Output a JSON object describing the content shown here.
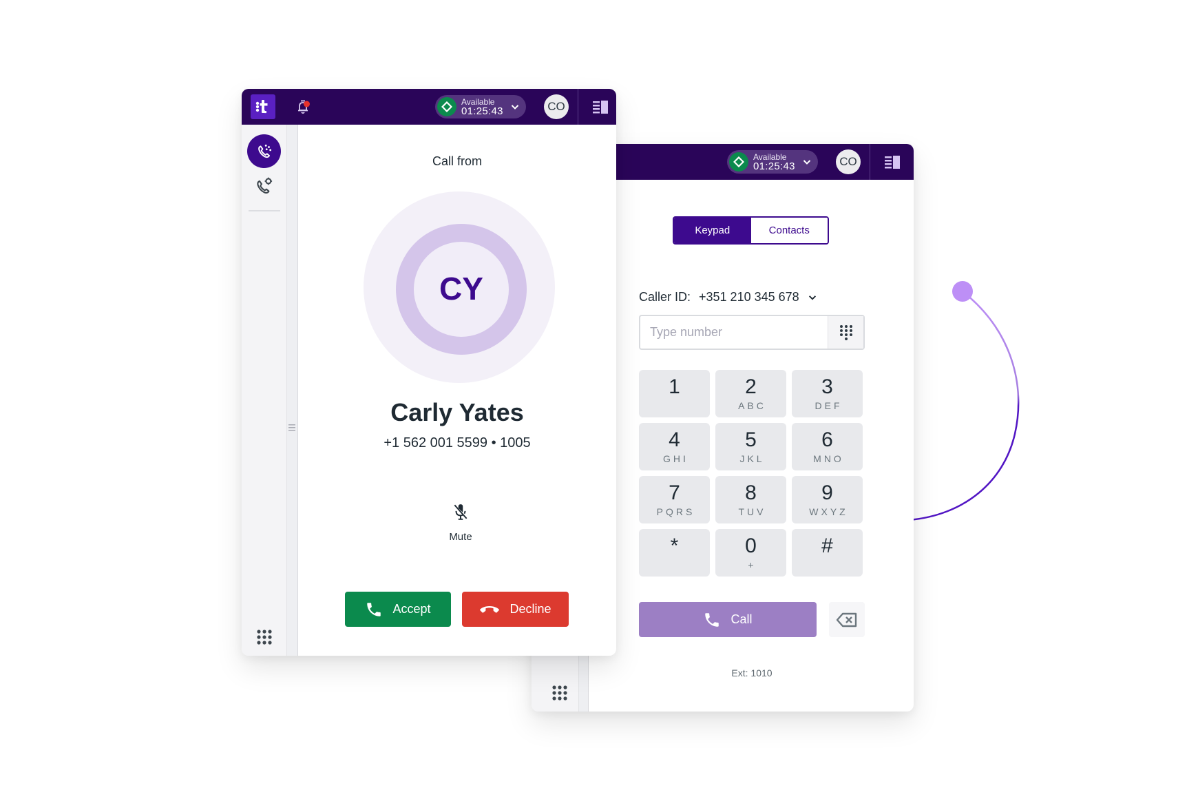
{
  "colors": {
    "header_bg": "#2a0559",
    "brand_purple": "#3d0a8e",
    "accept_green": "#0b8a4d",
    "decline_red": "#dc3a2f",
    "call_button_disabled": "#9c7fc4",
    "arc_light": "#bd8ff6",
    "arc_dark": "#5216c4"
  },
  "header": {
    "logo_icon": "talkdesk-logo-icon",
    "notification_icon": "bell-icon",
    "notification_badge": true,
    "status_label": "Available",
    "status_timer": "01:25:43",
    "status_icon": "diamond-icon",
    "user_initials": "CO",
    "panel_toggle_icon": "side-panel-icon"
  },
  "sidebar": {
    "items": [
      {
        "name": "incoming-call",
        "icon": "phone-ringing-icon",
        "active": true
      },
      {
        "name": "call-settings",
        "icon": "phone-settings-icon",
        "active": false
      }
    ],
    "apps_icon": "apps-grid-icon"
  },
  "incoming_call": {
    "heading": "Call from",
    "initials": "CY",
    "caller_name": "Carly Yates",
    "caller_number": "+1 562 001 5599 • 1005",
    "mute_label": "Mute",
    "accept_label": "Accept",
    "decline_label": "Decline"
  },
  "dialer": {
    "tabs": [
      {
        "label": "Keypad",
        "active": true
      },
      {
        "label": "Contacts",
        "active": false
      }
    ],
    "caller_id_label": "Caller ID:",
    "caller_id_value": "+351 210 345 678",
    "number_input_value": "",
    "number_input_placeholder": "Type number",
    "keys": [
      {
        "digit": "1",
        "letters": ""
      },
      {
        "digit": "2",
        "letters": "ABC"
      },
      {
        "digit": "3",
        "letters": "DEF"
      },
      {
        "digit": "4",
        "letters": "GHI"
      },
      {
        "digit": "5",
        "letters": "JKL"
      },
      {
        "digit": "6",
        "letters": "MNO"
      },
      {
        "digit": "7",
        "letters": "PQRS"
      },
      {
        "digit": "8",
        "letters": "TUV"
      },
      {
        "digit": "9",
        "letters": "WXYZ"
      },
      {
        "digit": "*",
        "letters": ""
      },
      {
        "digit": "0",
        "letters": "+"
      },
      {
        "digit": "#",
        "letters": ""
      }
    ],
    "call_label": "Call",
    "extension": "Ext: 1010"
  }
}
